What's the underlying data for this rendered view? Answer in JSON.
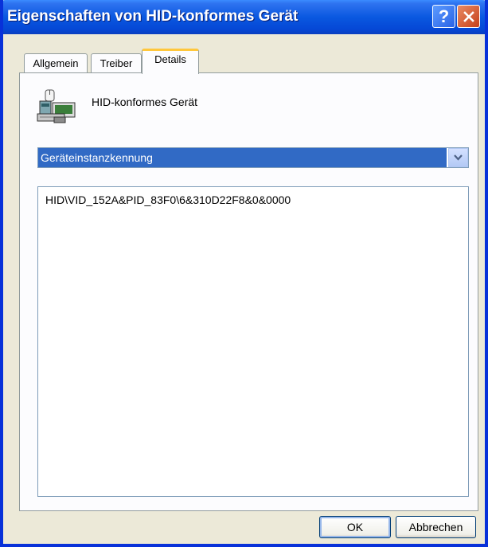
{
  "window": {
    "title": "Eigenschaften von HID-konformes Gerät",
    "help_icon": "question-mark-icon",
    "close_icon": "close-x-icon"
  },
  "tabs": [
    {
      "label": "Allgemein",
      "selected": false
    },
    {
      "label": "Treiber",
      "selected": false
    },
    {
      "label": "Details",
      "selected": true
    }
  ],
  "details": {
    "device_icon": "hid-device-icon",
    "device_name": "HID-konformes Gerät",
    "property_selected": "Geräteinstanzkennung",
    "values": [
      "HID\\VID_152A&PID_83F0\\6&310D22F8&0&0000"
    ]
  },
  "buttons": {
    "ok": "OK",
    "cancel": "Abbrechen"
  },
  "colors": {
    "titlebar": "#0A58E0",
    "selection": "#316AC5",
    "dialog_bg": "#ECE9D8",
    "active_tab_highlight": "#FFC73C"
  }
}
